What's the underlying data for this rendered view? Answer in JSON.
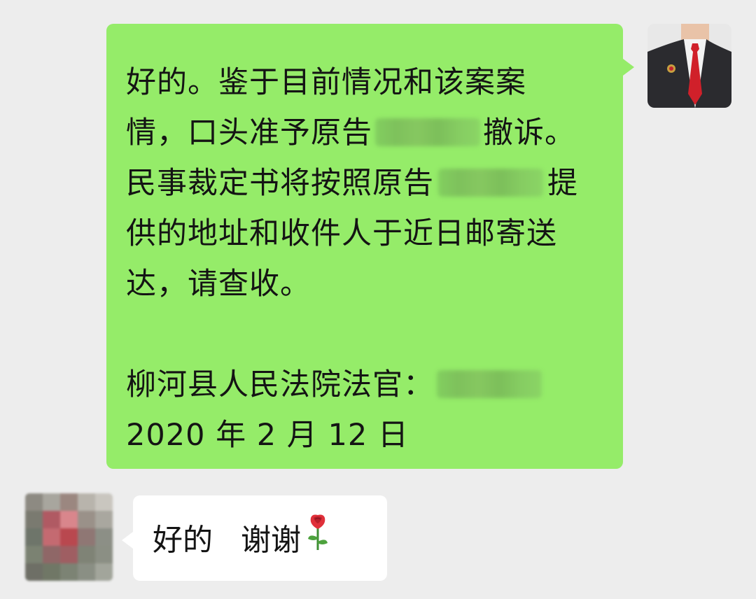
{
  "outgoing_message": {
    "lines": [
      [
        "好的。鉴于目前情况和该案案"
      ],
      [
        "情，口头准予原告",
        "",
        "撤诉。"
      ],
      [
        "民事裁定书将按照原告",
        "",
        "提"
      ],
      [
        "供的地址和收件人于近日邮寄送"
      ],
      [
        "达，请查收。"
      ]
    ],
    "line1": "好的。鉴于目前情况和该案案",
    "line2_a": "情，口头准予原告",
    "line2_b": "撤诉。",
    "line3_a": "民事裁定书将按照原告",
    "line3_b": "提",
    "line4": "供的地址和收件人于近日邮寄送",
    "line5": "达，请查收。",
    "signature": "柳河县人民法院法官：",
    "date": "2020 年 2 月 12 日"
  },
  "incoming_message": {
    "text_a": "好的",
    "text_b": "谢谢",
    "emoji": "rose-icon"
  },
  "colors": {
    "background": "#ededed",
    "outgoing_bubble": "#95ec69",
    "incoming_bubble": "#ffffff"
  }
}
